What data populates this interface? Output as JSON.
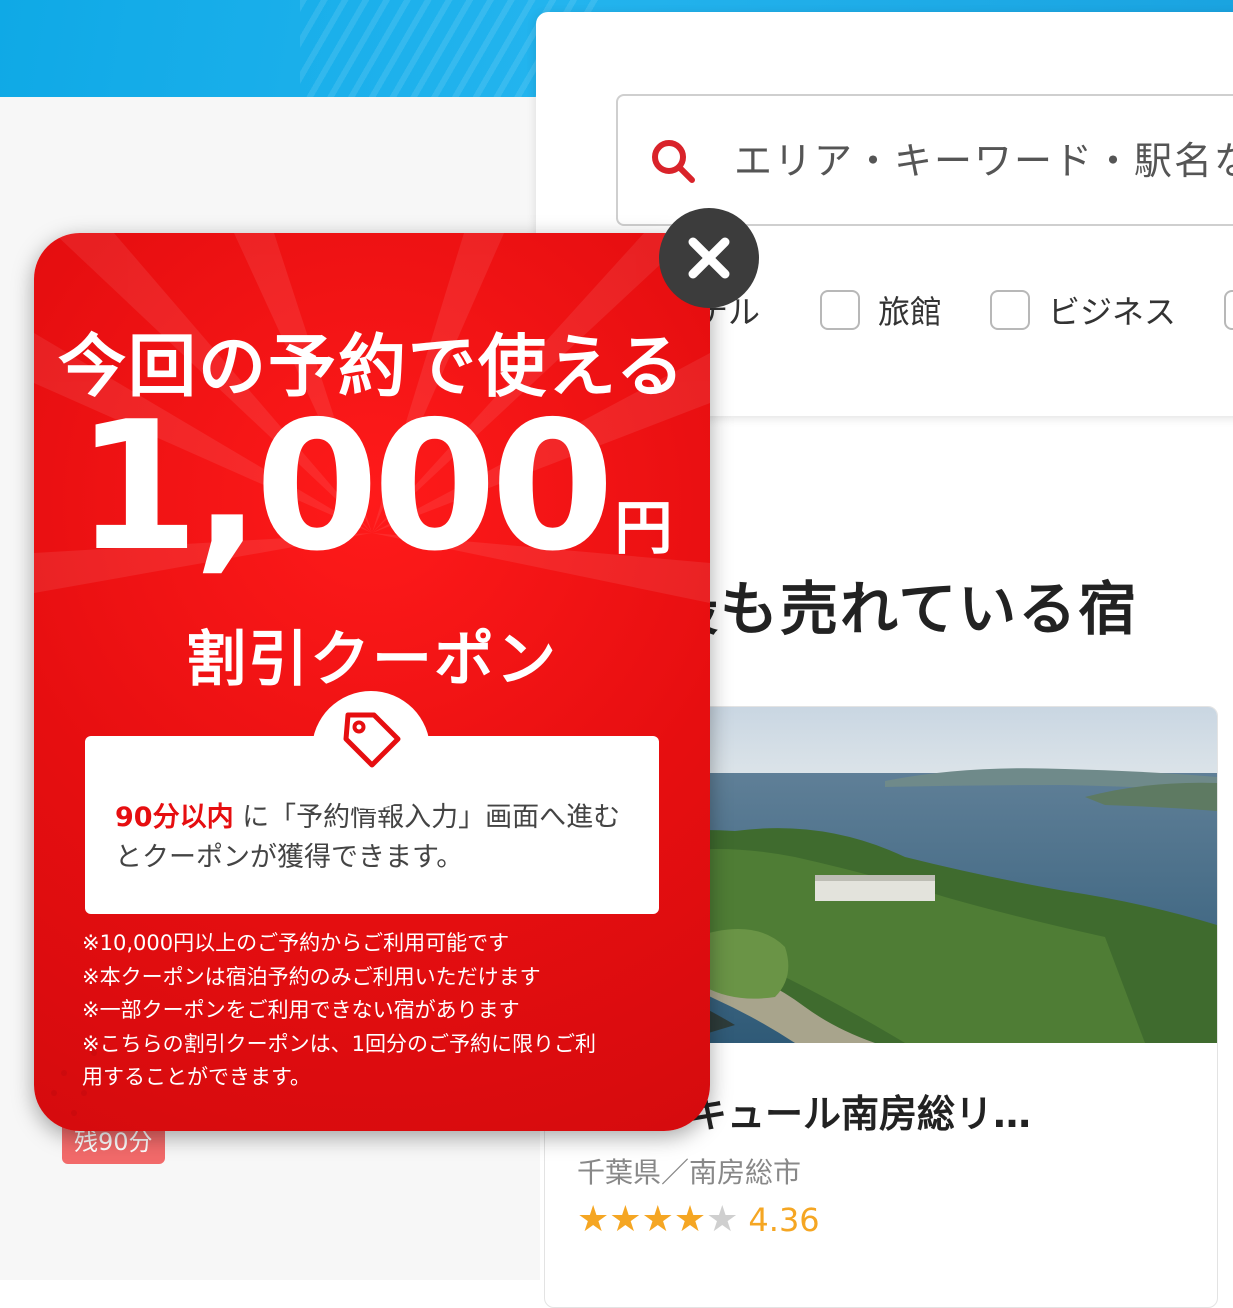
{
  "search": {
    "placeholder": "エリア・キーワード・駅名な",
    "filters": {
      "partial": "テル",
      "ryokan": "旅館",
      "business": "ビジネス"
    }
  },
  "section": {
    "title": "最も売れている宿"
  },
  "hotel": {
    "name": "ドメルキュール南房総リ…",
    "location": "千葉県／南房総市",
    "rating": "4.36",
    "rating_stars": 4
  },
  "badge": {
    "remaining": "残90分"
  },
  "popup": {
    "headline": "今回の予約で使える",
    "amount": "1,000",
    "unit": "円",
    "subtitle": "割引クーポン",
    "info_highlight": "90分以内",
    "info_text": " に「予約情報入力」画面へ進むとクーポンが獲得できます。",
    "notes": [
      "※10,000円以上のご予約からご利用可能です",
      "※本クーポンは宿泊予約のみご利用いただけます",
      "※一部クーポンをご利用できない宿があります",
      "※こちらの割引クーポンは、1回分のご予約に限りご利",
      "用することができます。"
    ]
  },
  "colors": {
    "popup_red": "#e60e10",
    "header_blue": "#1aa3e0",
    "star": "#f5a623",
    "close_button": "#3c3c3c",
    "badge": "#f26a6a"
  },
  "icons": {
    "search": "search-icon",
    "close": "close-icon",
    "tag": "tag-icon",
    "star": "star-icon"
  }
}
